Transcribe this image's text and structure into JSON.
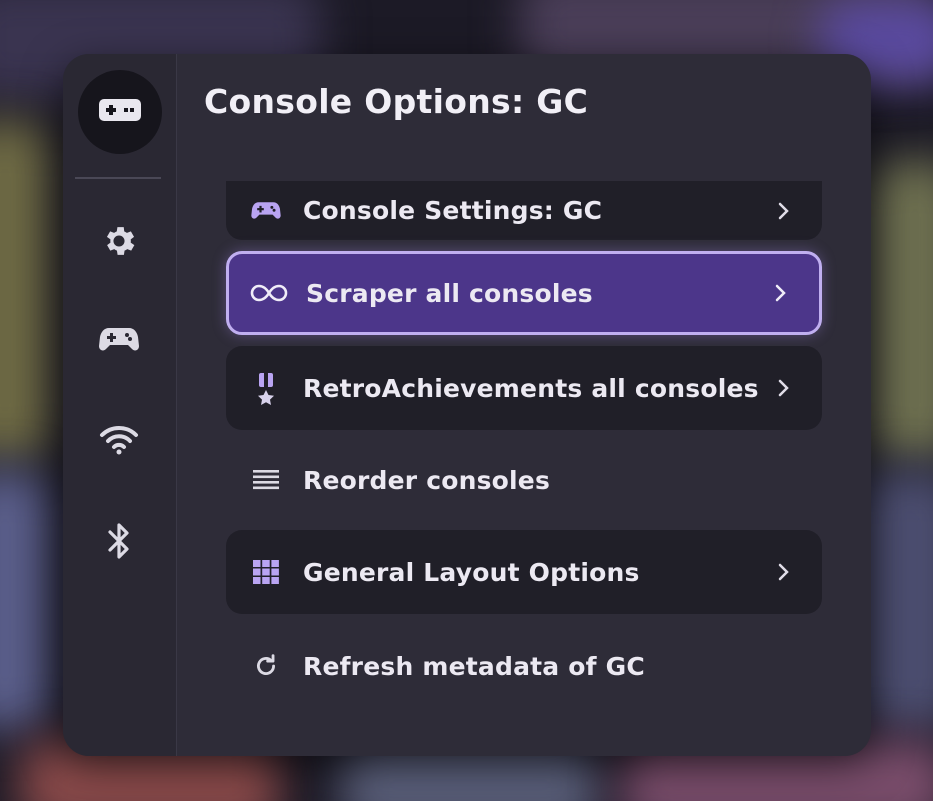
{
  "header": {
    "title": "Console Options: GC"
  },
  "rail": {
    "items": [
      {
        "icon": "controller-badge-icon"
      },
      {
        "icon": "gear-icon"
      },
      {
        "icon": "gamepad-icon"
      },
      {
        "icon": "wifi-icon"
      },
      {
        "icon": "bluetooth-icon"
      }
    ]
  },
  "menu": {
    "items": [
      {
        "label": "Console Settings: GC",
        "icon": "gamepad-icon",
        "has_chevron": true
      },
      {
        "label": "Scraper all consoles",
        "icon": "infinity-icon",
        "has_chevron": true,
        "selected": true
      },
      {
        "label": "RetroAchievements all consoles",
        "icon": "medal-icon",
        "has_chevron": true
      },
      {
        "label": "Reorder consoles",
        "icon": "list-icon",
        "has_chevron": false
      },
      {
        "label": "General Layout Options",
        "icon": "grid-icon",
        "has_chevron": true
      },
      {
        "label": "Refresh metadata of GC",
        "icon": "refresh-icon",
        "has_chevron": false
      }
    ]
  },
  "colors": {
    "accent": "#4c368a",
    "accent_border": "#c0aff0",
    "icon_purple": "#b9a4f2",
    "panel": "#2e2c38"
  }
}
